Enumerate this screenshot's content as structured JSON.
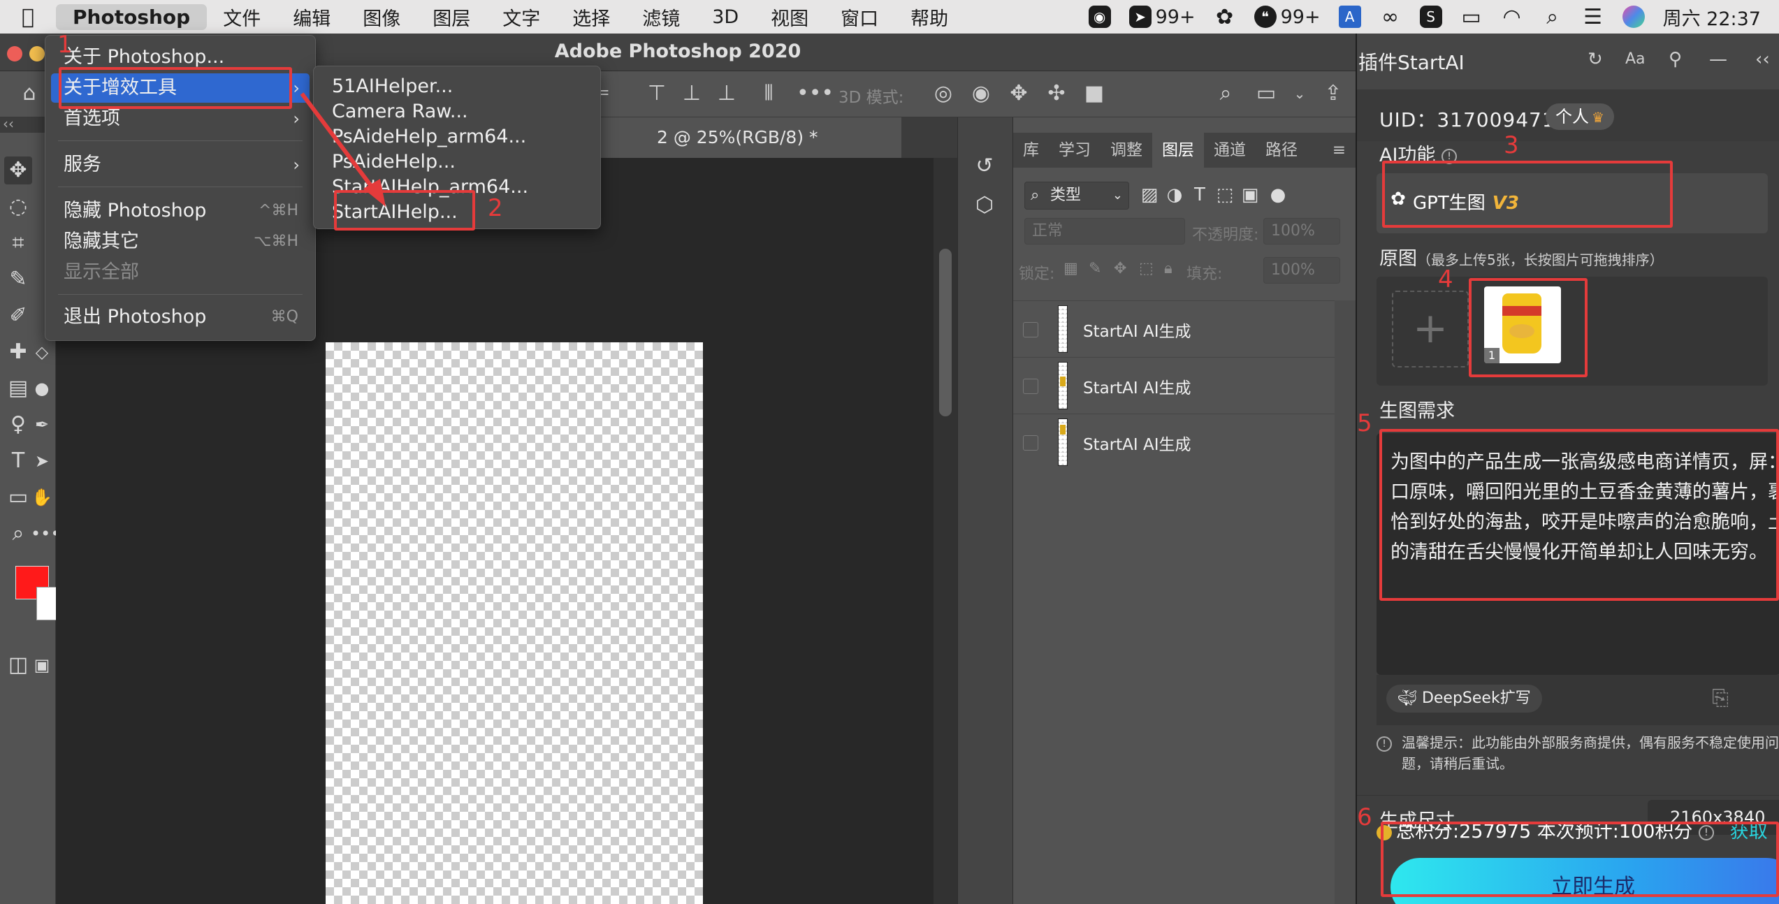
{
  "menubar": {
    "app_name": "Photoshop",
    "items": [
      "文件",
      "编辑",
      "图像",
      "图层",
      "文字",
      "选择",
      "滤镜",
      "3D",
      "视图",
      "窗口",
      "帮助"
    ],
    "tray": {
      "badge1": "99+",
      "badge2": "99+",
      "clock": "周六 22:37"
    }
  },
  "window": {
    "title": "Adobe Photoshop 2020"
  },
  "options_bar": {
    "mode_label": "3D 模式:"
  },
  "document": {
    "tab_label": "2 @ 25%(RGB/8) *"
  },
  "ps_menu": {
    "items": [
      {
        "label": "关于 Photoshop..."
      },
      {
        "label": "关于增效工具"
      },
      {
        "label": "首选项"
      },
      {
        "label": "服务"
      },
      {
        "label": "隐藏 Photoshop",
        "shortcut": "^⌘H"
      },
      {
        "label": "隐藏其它",
        "shortcut": "⌥⌘H"
      },
      {
        "label": "显示全部"
      },
      {
        "label": "退出 Photoshop",
        "shortcut": "⌘Q"
      }
    ]
  },
  "plugin_submenu": {
    "items": [
      "51AIHelper...",
      "Camera Raw...",
      "PsAideHelp_arm64...",
      "PsAideHelp...",
      "StartAIHelp_arm64...",
      "StartAIHelp..."
    ]
  },
  "layers_panel": {
    "tabs": [
      "库",
      "学习",
      "调整",
      "图层",
      "通道",
      "路径"
    ],
    "active_tab": "图层",
    "filter_label": "类型",
    "blend_mode": "正常",
    "opacity_label": "不透明度:",
    "opacity_value": "100%",
    "lock_label": "锁定:",
    "fill_label": "填充:",
    "fill_value": "100%",
    "layers": [
      {
        "name": "StartAI AI生成"
      },
      {
        "name": "StartAI AI生成"
      },
      {
        "name": "StartAI AI生成"
      }
    ]
  },
  "startai": {
    "title": "插件StartAI",
    "font_btn": "Aa",
    "uid_label": "UID：317009471",
    "account_badge": "个人",
    "ai_function_label": "AI功能",
    "gpt_label": "GPT生图",
    "gpt_version": "V3",
    "source_label": "原图",
    "source_hint": "（最多上传5张，长按图片可拖拽排序）",
    "thumb_index": "1",
    "prompt_label": "生图需求",
    "prompt_text": "为图中的产品生成一张高级感电商详情页，屏：一口原味，嚼回阳光里的土豆香金黄薄的薯片，裹着恰到好处的海盐，咬开是咔嚓声的治愈脆响，土豆的清甜在舌尖慢慢化开简单却让人回味无穷。",
    "deepseek_label": "DeepSeek扩写",
    "warning": "温馨提示：此功能由外部服务商提供，偶有服务不稳定使用问题，请稍后重试。",
    "size_label": "生成尺寸",
    "size_value": "2160x3840",
    "points_text": "总积分:257975  本次预计:100积分",
    "get_more": "获取",
    "generate_label": "立即生成"
  },
  "annotations": {
    "n1": "1",
    "n2": "2",
    "n3": "3",
    "n4": "4",
    "n5": "5",
    "n6": "6"
  },
  "colors": {
    "foreground": "#ff1a1a",
    "background": "#ffffff",
    "menu_highlight": "#2f68d0",
    "annotation": "#e53b3b"
  }
}
